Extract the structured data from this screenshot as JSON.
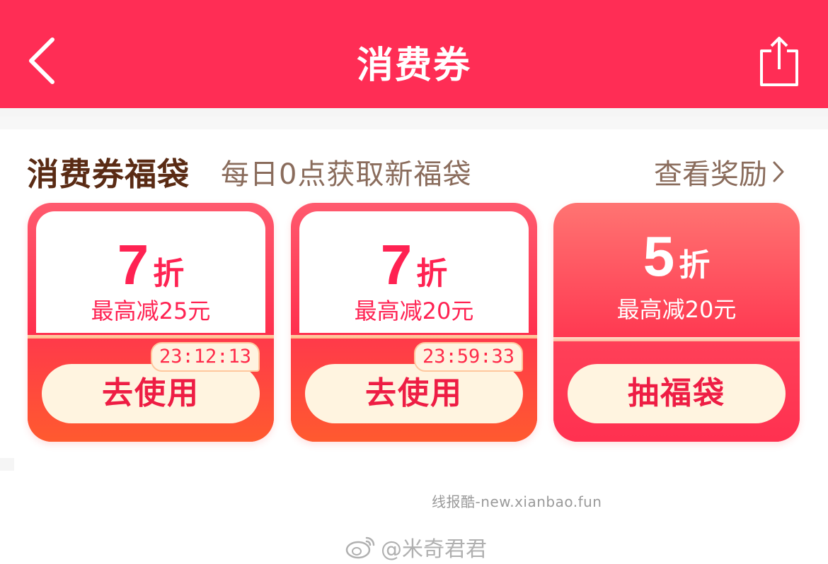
{
  "header": {
    "title": "消费券"
  },
  "section": {
    "title": "消费券福袋",
    "subtitle": "每日0点获取新福袋",
    "view_rewards": "查看奖励"
  },
  "cards": [
    {
      "discount": "7",
      "unit": "折",
      "cap": "最高减25元",
      "timer": "23:12:13",
      "button": "去使用"
    },
    {
      "discount": "7",
      "unit": "折",
      "cap": "最高减20元",
      "timer": "23:59:33",
      "button": "去使用"
    },
    {
      "discount": "5",
      "unit": "折",
      "cap": "最高减20元",
      "button": "抽福袋"
    }
  ],
  "watermarks": {
    "site": "线报酷-new.xianbao.fun",
    "author": "@米奇君君"
  },
  "icons": {
    "back": "back-chevron-icon",
    "share": "share-icon",
    "chevron": "chevron-right-icon",
    "weibo": "weibo-logo-icon"
  },
  "colors": {
    "header": "#ff2d55",
    "accent": "#ff2252",
    "button_bg": "#fff4e0"
  }
}
